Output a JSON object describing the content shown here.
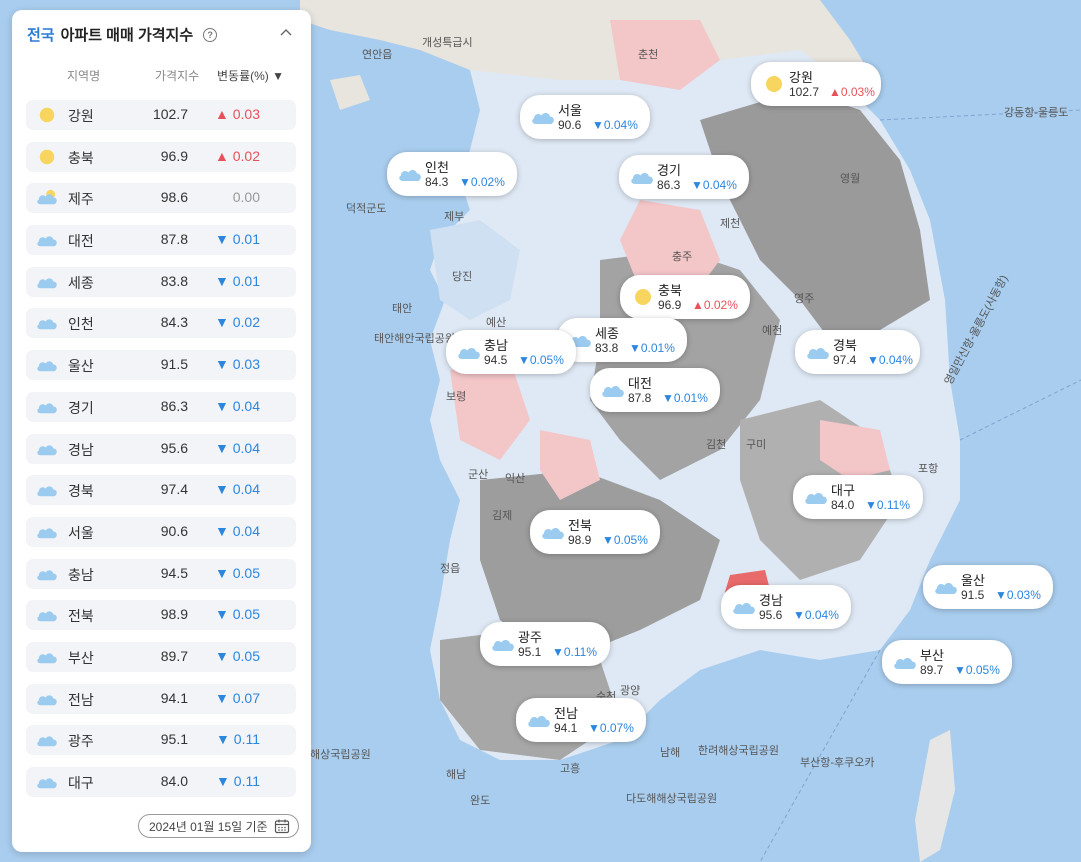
{
  "panel": {
    "title_scope": "전국",
    "title_rest": "아파트 매매 가격지수",
    "help_icon": "help-circle-icon",
    "collapse_icon": "chevron-up-icon",
    "columns": {
      "region": "지역명",
      "index": "가격지수",
      "change": "변동률(%)",
      "sort_arrow": "▼"
    },
    "date": "2024년 01월 15일 기준",
    "calendar_icon": "calendar-icon",
    "rows": [
      {
        "name": "강원",
        "index": "102.7",
        "change": "0.03",
        "dir": "up",
        "weather": "sun"
      },
      {
        "name": "충북",
        "index": "96.9",
        "change": "0.02",
        "dir": "up",
        "weather": "sun"
      },
      {
        "name": "제주",
        "index": "98.6",
        "change": "0.00",
        "dir": "flat",
        "weather": "partly-cloudy"
      },
      {
        "name": "대전",
        "index": "87.8",
        "change": "0.01",
        "dir": "down",
        "weather": "cloud"
      },
      {
        "name": "세종",
        "index": "83.8",
        "change": "0.01",
        "dir": "down",
        "weather": "cloud"
      },
      {
        "name": "인천",
        "index": "84.3",
        "change": "0.02",
        "dir": "down",
        "weather": "cloud"
      },
      {
        "name": "울산",
        "index": "91.5",
        "change": "0.03",
        "dir": "down",
        "weather": "cloud"
      },
      {
        "name": "경기",
        "index": "86.3",
        "change": "0.04",
        "dir": "down",
        "weather": "cloud"
      },
      {
        "name": "경남",
        "index": "95.6",
        "change": "0.04",
        "dir": "down",
        "weather": "cloud"
      },
      {
        "name": "경북",
        "index": "97.4",
        "change": "0.04",
        "dir": "down",
        "weather": "cloud"
      },
      {
        "name": "서울",
        "index": "90.6",
        "change": "0.04",
        "dir": "down",
        "weather": "cloud"
      },
      {
        "name": "충남",
        "index": "94.5",
        "change": "0.05",
        "dir": "down",
        "weather": "cloud"
      },
      {
        "name": "전북",
        "index": "98.9",
        "change": "0.05",
        "dir": "down",
        "weather": "cloud"
      },
      {
        "name": "부산",
        "index": "89.7",
        "change": "0.05",
        "dir": "down",
        "weather": "cloud"
      },
      {
        "name": "전남",
        "index": "94.1",
        "change": "0.07",
        "dir": "down",
        "weather": "cloud"
      },
      {
        "name": "광주",
        "index": "95.1",
        "change": "0.11",
        "dir": "down",
        "weather": "cloud"
      },
      {
        "name": "대구",
        "index": "84.0",
        "change": "0.11",
        "dir": "down",
        "weather": "cloud"
      }
    ]
  },
  "map": {
    "colors": {
      "sea": "#a9cdee",
      "land_gray": "#9a9a9a",
      "land_light": "#dfe9f5",
      "land_pink": "#f3c6c8",
      "accent_up": "#e8515a",
      "accent_down": "#2b86e0"
    },
    "bubbles": [
      {
        "name": "강원",
        "index": "102.7",
        "change": "0.03",
        "dir": "up",
        "weather": "sun"
      },
      {
        "name": "서울",
        "index": "90.6",
        "change": "0.04",
        "dir": "down",
        "weather": "cloud"
      },
      {
        "name": "인천",
        "index": "84.3",
        "change": "0.02",
        "dir": "down",
        "weather": "cloud"
      },
      {
        "name": "경기",
        "index": "86.3",
        "change": "0.04",
        "dir": "down",
        "weather": "cloud"
      },
      {
        "name": "충북",
        "index": "96.9",
        "change": "0.02",
        "dir": "up",
        "weather": "sun"
      },
      {
        "name": "세종",
        "index": "83.8",
        "change": "0.01",
        "dir": "down",
        "weather": "cloud"
      },
      {
        "name": "충남",
        "index": "94.5",
        "change": "0.05",
        "dir": "down",
        "weather": "cloud"
      },
      {
        "name": "대전",
        "index": "87.8",
        "change": "0.01",
        "dir": "down",
        "weather": "cloud"
      },
      {
        "name": "경북",
        "index": "97.4",
        "change": "0.04",
        "dir": "down",
        "weather": "cloud"
      },
      {
        "name": "대구",
        "index": "84.0",
        "change": "0.11",
        "dir": "down",
        "weather": "cloud"
      },
      {
        "name": "전북",
        "index": "98.9",
        "change": "0.05",
        "dir": "down",
        "weather": "cloud"
      },
      {
        "name": "울산",
        "index": "91.5",
        "change": "0.03",
        "dir": "down",
        "weather": "cloud"
      },
      {
        "name": "경남",
        "index": "95.6",
        "change": "0.04",
        "dir": "down",
        "weather": "cloud"
      },
      {
        "name": "광주",
        "index": "95.1",
        "change": "0.11",
        "dir": "down",
        "weather": "cloud"
      },
      {
        "name": "부산",
        "index": "89.7",
        "change": "0.05",
        "dir": "down",
        "weather": "cloud"
      },
      {
        "name": "전남",
        "index": "94.1",
        "change": "0.07",
        "dir": "down",
        "weather": "cloud"
      }
    ],
    "labels": [
      "연안읍",
      "개성특급시",
      "덕적군도",
      "제부",
      "당진",
      "태안",
      "태안해안국립공원",
      "예산",
      "보령",
      "군산",
      "익산",
      "김제",
      "정읍",
      "광양",
      "해남",
      "완도",
      "고흥",
      "순천",
      "남해",
      "김천",
      "구미",
      "영주",
      "예천",
      "포항",
      "춘천",
      "원주",
      "충주",
      "영월",
      "제천",
      "강동항-울릉도",
      "영일만신항-울릉도(사동항)",
      "다도해해상국립공원",
      "한려해상국립공원",
      "해상국립공원",
      "부산항-후쿠오카"
    ]
  }
}
